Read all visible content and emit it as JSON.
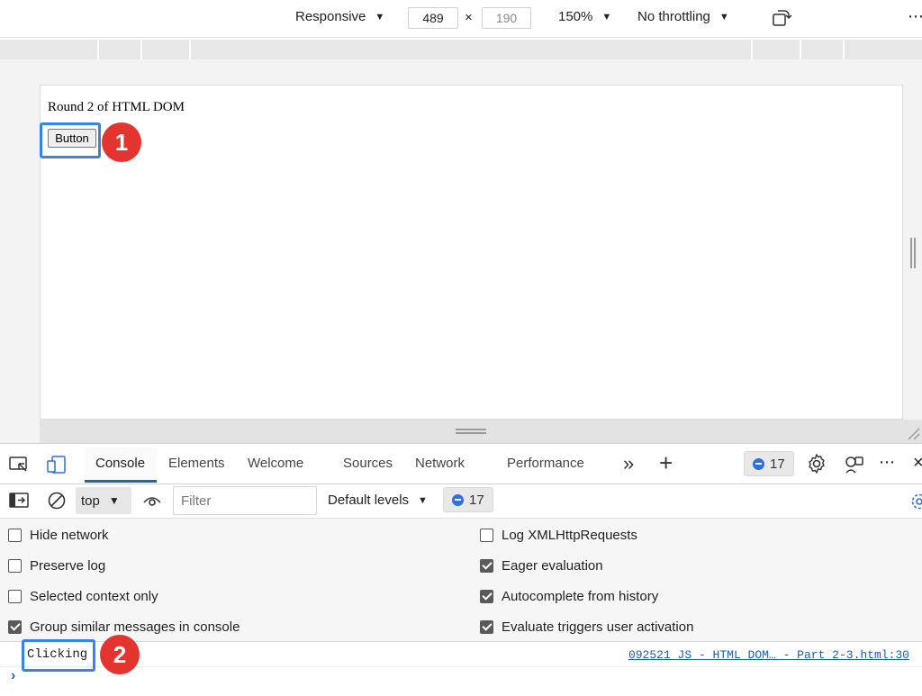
{
  "device_toolbar": {
    "device": "Responsive",
    "width": "489",
    "height": "190",
    "zoom": "150%",
    "throttling": "No throttling",
    "more_label": "⋮"
  },
  "page": {
    "heading": "Round 2 of HTML DOM",
    "button_label": "Button"
  },
  "annotations": {
    "badge1": "1",
    "badge2": "2",
    "highlight_color": "#3b82e6",
    "badge_color": "#e3342f"
  },
  "devtools": {
    "tabs": [
      "Console",
      "Elements",
      "Welcome",
      "Sources",
      "Network",
      "Performance"
    ],
    "active_tab": "Console",
    "more_tabs": "»",
    "add_tab": "+",
    "issues_count": "17",
    "more_menu": "⋯",
    "close": "×"
  },
  "console_toolbar": {
    "context": "top",
    "filter_placeholder": "Filter",
    "levels": "Default levels",
    "issues_count": "17"
  },
  "settings": {
    "left": [
      {
        "label": "Hide network",
        "checked": false
      },
      {
        "label": "Preserve log",
        "checked": false
      },
      {
        "label": "Selected context only",
        "checked": false
      },
      {
        "label": "Group similar messages in console",
        "checked": true
      }
    ],
    "right": [
      {
        "label": "Log XMLHttpRequests",
        "checked": false
      },
      {
        "label": "Eager evaluation",
        "checked": true
      },
      {
        "label": "Autocomplete from history",
        "checked": true
      },
      {
        "label": "Evaluate triggers user activation",
        "checked": true
      }
    ]
  },
  "console_output": {
    "message": "Clicking",
    "source": "092521 JS - HTML DOM… - Part 2-3.html:30",
    "prompt": "›"
  }
}
